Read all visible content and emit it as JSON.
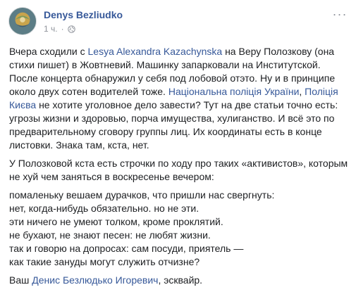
{
  "post": {
    "author": "Denys Bezliudko",
    "time": "1 ч.",
    "dot": "·",
    "more": "···"
  },
  "p1": {
    "a": "Вчера сходили с ",
    "link_lesya": "Lesya Alexandra Kazachynska",
    "b": " на Веру Полозкову (она стихи пишет) в Жовтневий. Машинку запарковали на Институтской. После концерта обнаружил у себя под лобовой отэто. Ну и в принципе около двух сотен водителей тоже. ",
    "link_police": "Національна поліція України",
    "comma": ", ",
    "link_police_kyiv": "Поліція Києва",
    "c": " не хотите уголовное дело завести? Тут на две статьи точно есть: угрозы жизни и здоровью, порча имущества, хулиганство. И всё это по предварительному сговору группы лиц. Их координаты есть в конце листовки. Знака там, кста, нет."
  },
  "p2": "У Полозковой кста есть строчки по ходу про таких «активистов», которым не хуй чем заняться в воскресенье вечером:",
  "poem": [
    "помаленьку вешаем дурачков, что пришли нас свергнуть:",
    "нет, когда-нибудь обязательно. но не эти.",
    "эти ничего не умеют толком, кроме проклятий.",
    "не бухают, не знают песен: не любят жизни.",
    "так и говорю на допросах: сам посуди, приятель —",
    "как такие зануды могут служить отчизне?"
  ],
  "sign": {
    "a": "Ваш ",
    "link_name": "Денис Безлюдько Игоревич",
    "b": ", эсквайр."
  }
}
